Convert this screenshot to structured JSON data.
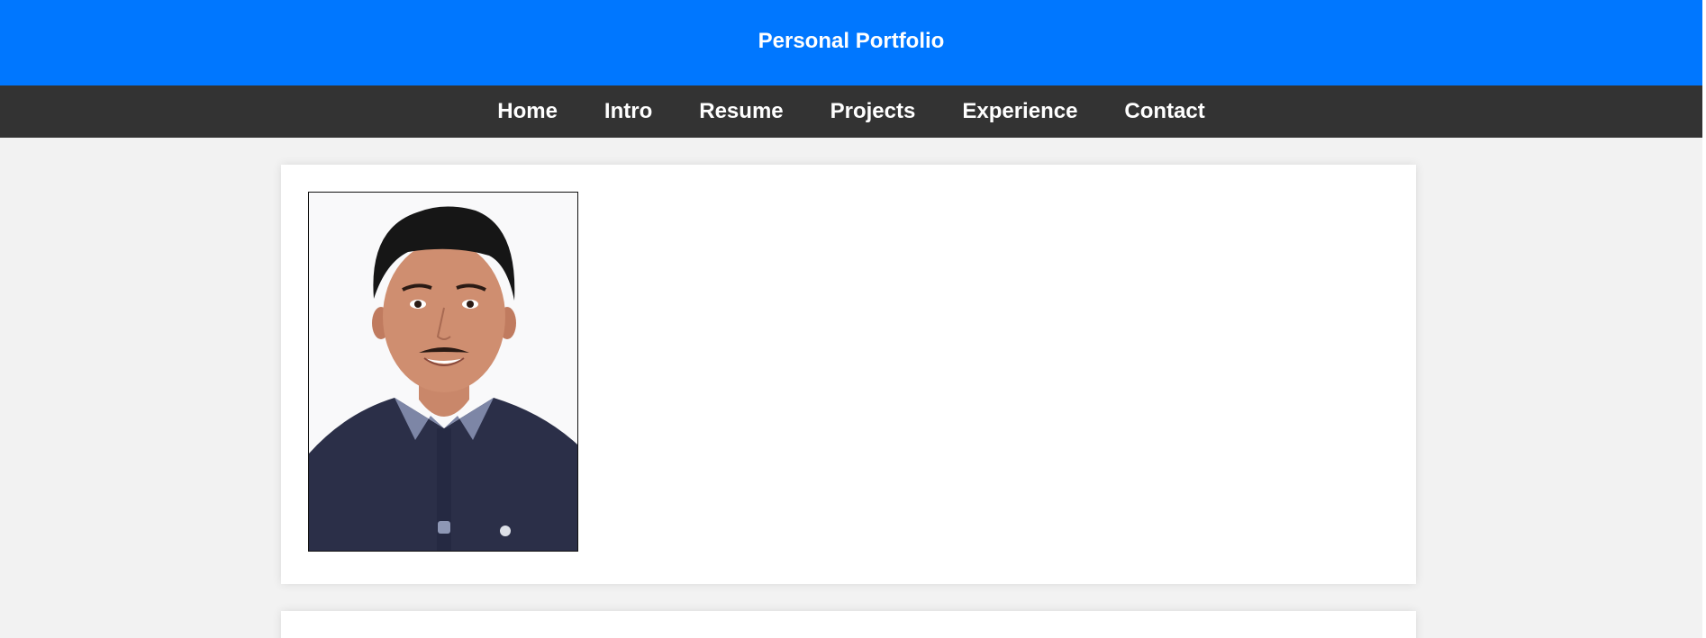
{
  "header": {
    "title": "Personal Portfolio"
  },
  "nav": {
    "items": [
      {
        "label": "Home"
      },
      {
        "label": "Intro"
      },
      {
        "label": "Resume"
      },
      {
        "label": "Projects"
      },
      {
        "label": "Experience"
      },
      {
        "label": "Contact"
      }
    ]
  },
  "profile": {
    "photo_alt": "Profile photo"
  },
  "colors": {
    "header_bg": "#0077ff",
    "nav_bg": "#333333",
    "page_bg": "#f2f2f2",
    "card_bg": "#ffffff"
  }
}
